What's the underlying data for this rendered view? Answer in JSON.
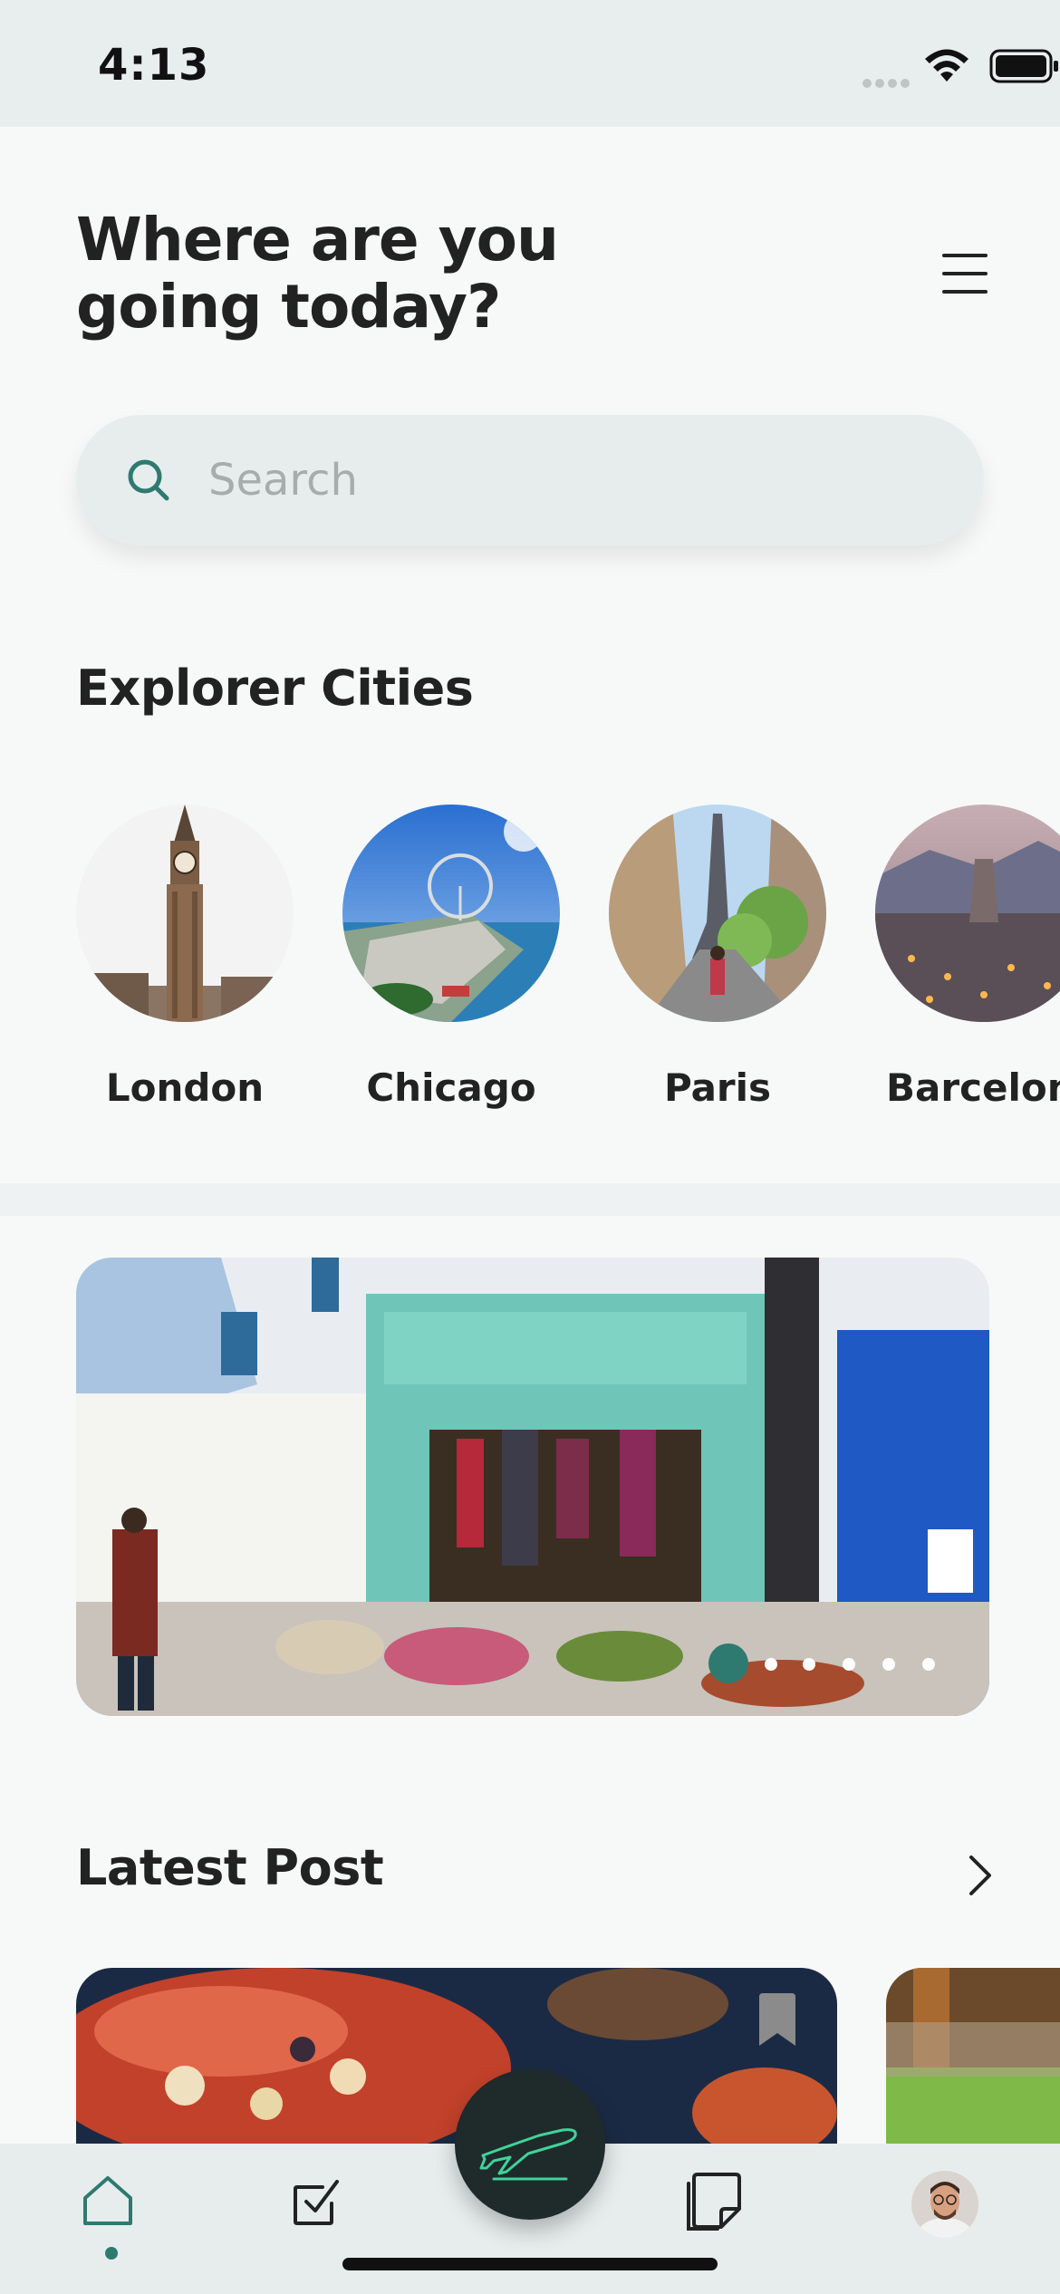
{
  "status_bar": {
    "time": "4:13"
  },
  "header": {
    "title": "Where are you going today?"
  },
  "search": {
    "placeholder": "Search"
  },
  "explorer": {
    "title": "Explorer Cities",
    "cities": [
      {
        "name": "London"
      },
      {
        "name": "Chicago"
      },
      {
        "name": "Paris"
      },
      {
        "name": "Barcelona"
      }
    ]
  },
  "banner": {
    "page_count": 6,
    "active_page": 1
  },
  "latest_post": {
    "title": "Latest Post"
  },
  "tab_bar": {
    "items": [
      "home-icon",
      "tasks-icon",
      "flights-icon",
      "notes-icon",
      "profile-avatar"
    ],
    "active": "home",
    "accent_color": "#2f7a70"
  }
}
